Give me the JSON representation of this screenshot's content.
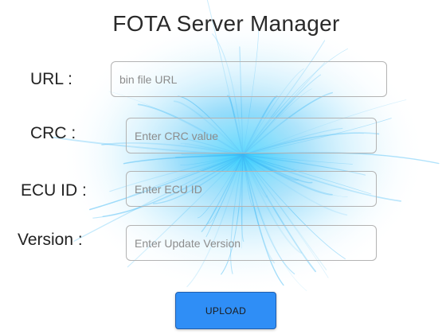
{
  "page": {
    "title": "FOTA Server Manager"
  },
  "form": {
    "url": {
      "label": "URL :",
      "placeholder": "bin file URL",
      "value": ""
    },
    "crc": {
      "label": "CRC :",
      "placeholder": "Enter CRC value",
      "value": ""
    },
    "ecu_id": {
      "label": "ECU ID :",
      "placeholder": "Enter ECU ID",
      "value": ""
    },
    "version": {
      "label": "Version :",
      "placeholder": "Enter Update Version",
      "value": ""
    }
  },
  "actions": {
    "upload_label": "UPLOAD"
  },
  "colors": {
    "accent": "#2f8ef6",
    "background_art": "#3fb8f5"
  },
  "icons": {
    "background": "cyan-energy-burst-art"
  }
}
